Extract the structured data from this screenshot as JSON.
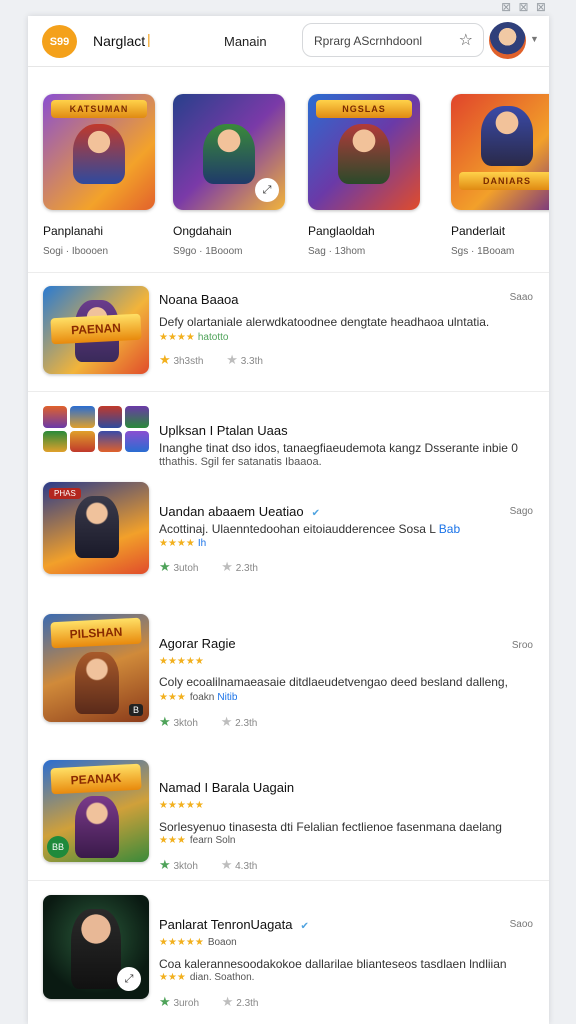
{
  "header": {
    "logo_text": "S99",
    "title": "Narglact",
    "menu_link": "Manain",
    "search_placeholder": "Rprarg AScrnhdoonl",
    "corner_glyphs": "⊠ ⊠ ⊠"
  },
  "featured": [
    {
      "title": "Panplanahi",
      "meta": "Sogi · Iboooen",
      "badge": "KATSUMAN"
    },
    {
      "title": "Ongdahain",
      "meta": "S9go · 1Booom"
    },
    {
      "title": "Panglaoldah",
      "meta": "Sag · 13hom",
      "badge": "NGSLAS"
    },
    {
      "title": "Panderlait",
      "meta": "Sgs · 1Booam",
      "badge": "DANIARS"
    }
  ],
  "list": [
    {
      "title": "Noana Baaoa",
      "side": "Saao",
      "desc": "Defy olartaniale alerwdkatoodnee dengtate headhaoa ulntatia.",
      "rating_stars": "★★★★",
      "rating_label": "hatotto",
      "stat1": "3h3sth",
      "stat2": "3.3th",
      "thumb_banner": "PAENAN"
    },
    {
      "title": "Uplksan I Ptalan Uaas",
      "desc": "Inanghe tinat dso idos, tanaegfiaeudemota kangz Dsserante inbie 0",
      "desc2": "tthathis. Sgil fer satanatis Ibaaoa."
    },
    {
      "title": "Uandan abaaem Ueatiao",
      "side": "Sago",
      "desc": "Acottinaj. Ulaenntedoohan eitoiaudderencee Sosa L",
      "desc_highlight": "Bab",
      "rating_stars": "★★★★",
      "rating_label": "Ih",
      "stat1": "3utoh",
      "stat2": "2.3th",
      "thumb_tag": "PHAS"
    },
    {
      "title": "Agorar Ragie",
      "side": "Sroo",
      "rating_stars": "★★★★★",
      "rating_tail": "★★",
      "desc": "Coly ecoalilnamaeasaie ditdlaeudetvengao deed besland dalleng,",
      "rating2_stars": "★★★",
      "rating2_gray": "foakn",
      "rating2_label": "Nitib",
      "stat1": "3ktoh",
      "stat2": "2.3th",
      "thumb_banner": "PILSHAN",
      "thumb_corner": "B"
    },
    {
      "title": "Namad I Barala Uagain",
      "rating_stars": "★★★★★",
      "desc": "Sorlesyenuo tinasesta dti Felalian fectlienoe fasenmana daelang",
      "rating2_stars": "★★★",
      "rating2_gray": "fearn Soln",
      "stat1": "3ktoh",
      "stat2": "4.3th",
      "thumb_banner": "PEANAK",
      "thumb_chip": "BB"
    },
    {
      "title": "Panlarat TenronUagata",
      "side": "Saoo",
      "rating_stars": "★★★★★",
      "rating_gray": "Boaon",
      "desc": "Coa kalerannesoodakokoe dallarilae blianteseos tasdlaen lndliian",
      "rating2_stars": "★★★",
      "rating2_gray": "dian. Soathon.",
      "stat1": "3uroh",
      "stat2": "2.3th"
    }
  ],
  "colors": {
    "accent": "#f4a11b",
    "star": "#f2b01e",
    "link": "#1a73e8",
    "green": "#4fa35a"
  },
  "icons": [
    "logo-icon",
    "star-icon",
    "avatar",
    "expand-icon",
    "star-rating-icon"
  ]
}
